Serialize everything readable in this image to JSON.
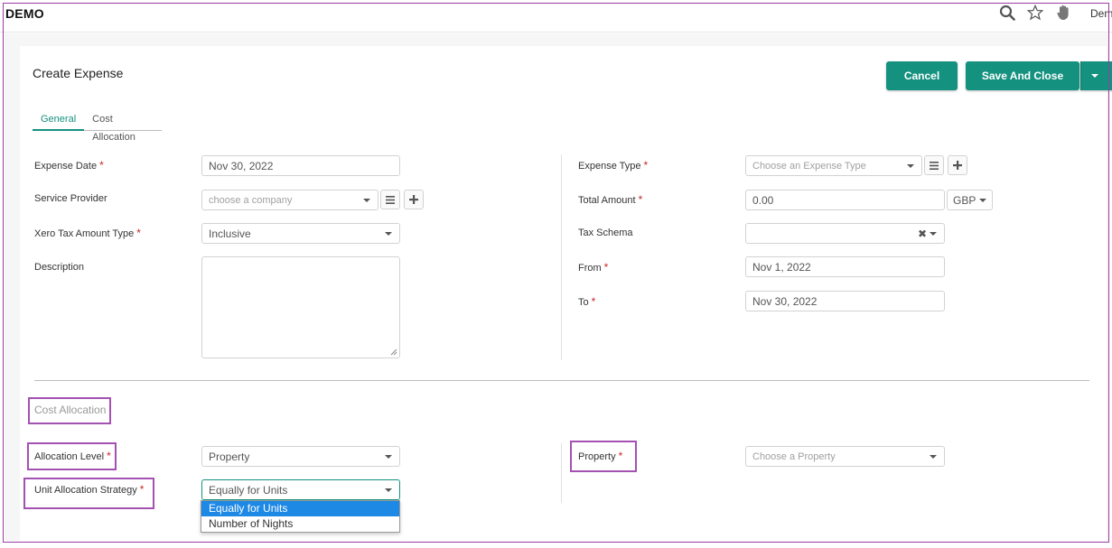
{
  "app": {
    "brand": "DEMO",
    "user": "Demo"
  },
  "icons": {
    "search": "search-icon",
    "star": "star-icon",
    "hand": "hand-icon"
  },
  "colors": {
    "accent": "#15917f",
    "required": "#c62828",
    "highlight": "#a352b2",
    "selected_option": "#1e88e5"
  },
  "page": {
    "title": "Create Expense"
  },
  "toolbar": {
    "cancel_label": "Cancel",
    "save_close_label": "Save And Close"
  },
  "tabs": [
    {
      "label": "General",
      "active": true
    },
    {
      "label": "Cost Allocation",
      "active": false
    }
  ],
  "form": {
    "expense_date": {
      "label": "Expense Date",
      "value": "Nov 30, 2022"
    },
    "service_provider": {
      "label": "Service Provider",
      "placeholder": "choose a company"
    },
    "xero_tax": {
      "label": "Xero Tax Amount Type",
      "value": "Inclusive"
    },
    "description": {
      "label": "Description",
      "value": ""
    },
    "expense_type": {
      "label": "Expense Type",
      "placeholder": "Choose an Expense Type"
    },
    "total_amount": {
      "label": "Total Amount",
      "value": "0.00",
      "currency": "GBP"
    },
    "tax_schema": {
      "label": "Tax Schema",
      "value": ""
    },
    "from": {
      "label": "From",
      "value": "Nov 1, 2022"
    },
    "to": {
      "label": "To",
      "value": "Nov 30, 2022"
    }
  },
  "cost_allocation": {
    "section_title": "Cost Allocation",
    "allocation_level": {
      "label": "Allocation Level",
      "value": "Property"
    },
    "property": {
      "label": "Property",
      "placeholder": "Choose a Property"
    },
    "unit_strategy": {
      "label": "Unit Allocation Strategy",
      "value": "Equally for Units",
      "options": [
        "Equally for Units",
        "Number of Nights"
      ]
    }
  }
}
